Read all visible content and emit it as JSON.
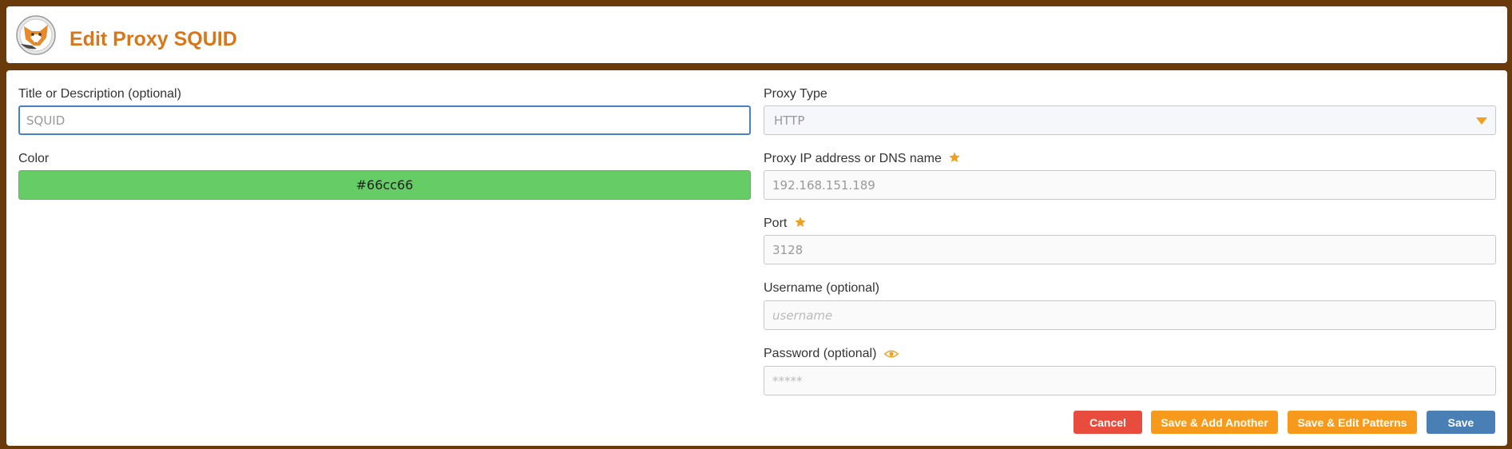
{
  "header": {
    "title": "Edit Proxy SQUID",
    "logo_icon": "fox-logo-icon"
  },
  "form": {
    "title_field": {
      "label": "Title or Description (optional)",
      "value": "SQUID",
      "placeholder": ""
    },
    "color_field": {
      "label": "Color",
      "value": "#66cc66"
    },
    "proxy_type": {
      "label": "Proxy Type",
      "value": "HTTP"
    },
    "address_field": {
      "label": "Proxy IP address or DNS name",
      "value": "192.168.151.189",
      "required_icon": "star-icon"
    },
    "port_field": {
      "label": "Port",
      "value": "3128",
      "required_icon": "star-icon"
    },
    "username_field": {
      "label": "Username (optional)",
      "value": "",
      "placeholder": "username"
    },
    "password_field": {
      "label": "Password (optional)",
      "value": "",
      "placeholder": "*****",
      "toggle_icon": "eye-icon"
    }
  },
  "buttons": {
    "cancel": "Cancel",
    "save_add_another": "Save & Add Another",
    "save_edit_patterns": "Save & Edit Patterns",
    "save": "Save"
  },
  "colors": {
    "background": "#6b3a0a",
    "title": "#d8761a",
    "accent_orange": "#f79a1c",
    "cancel_red": "#e74c3c",
    "save_blue": "#4a7fb5",
    "proxy_color": "#66cc66"
  }
}
